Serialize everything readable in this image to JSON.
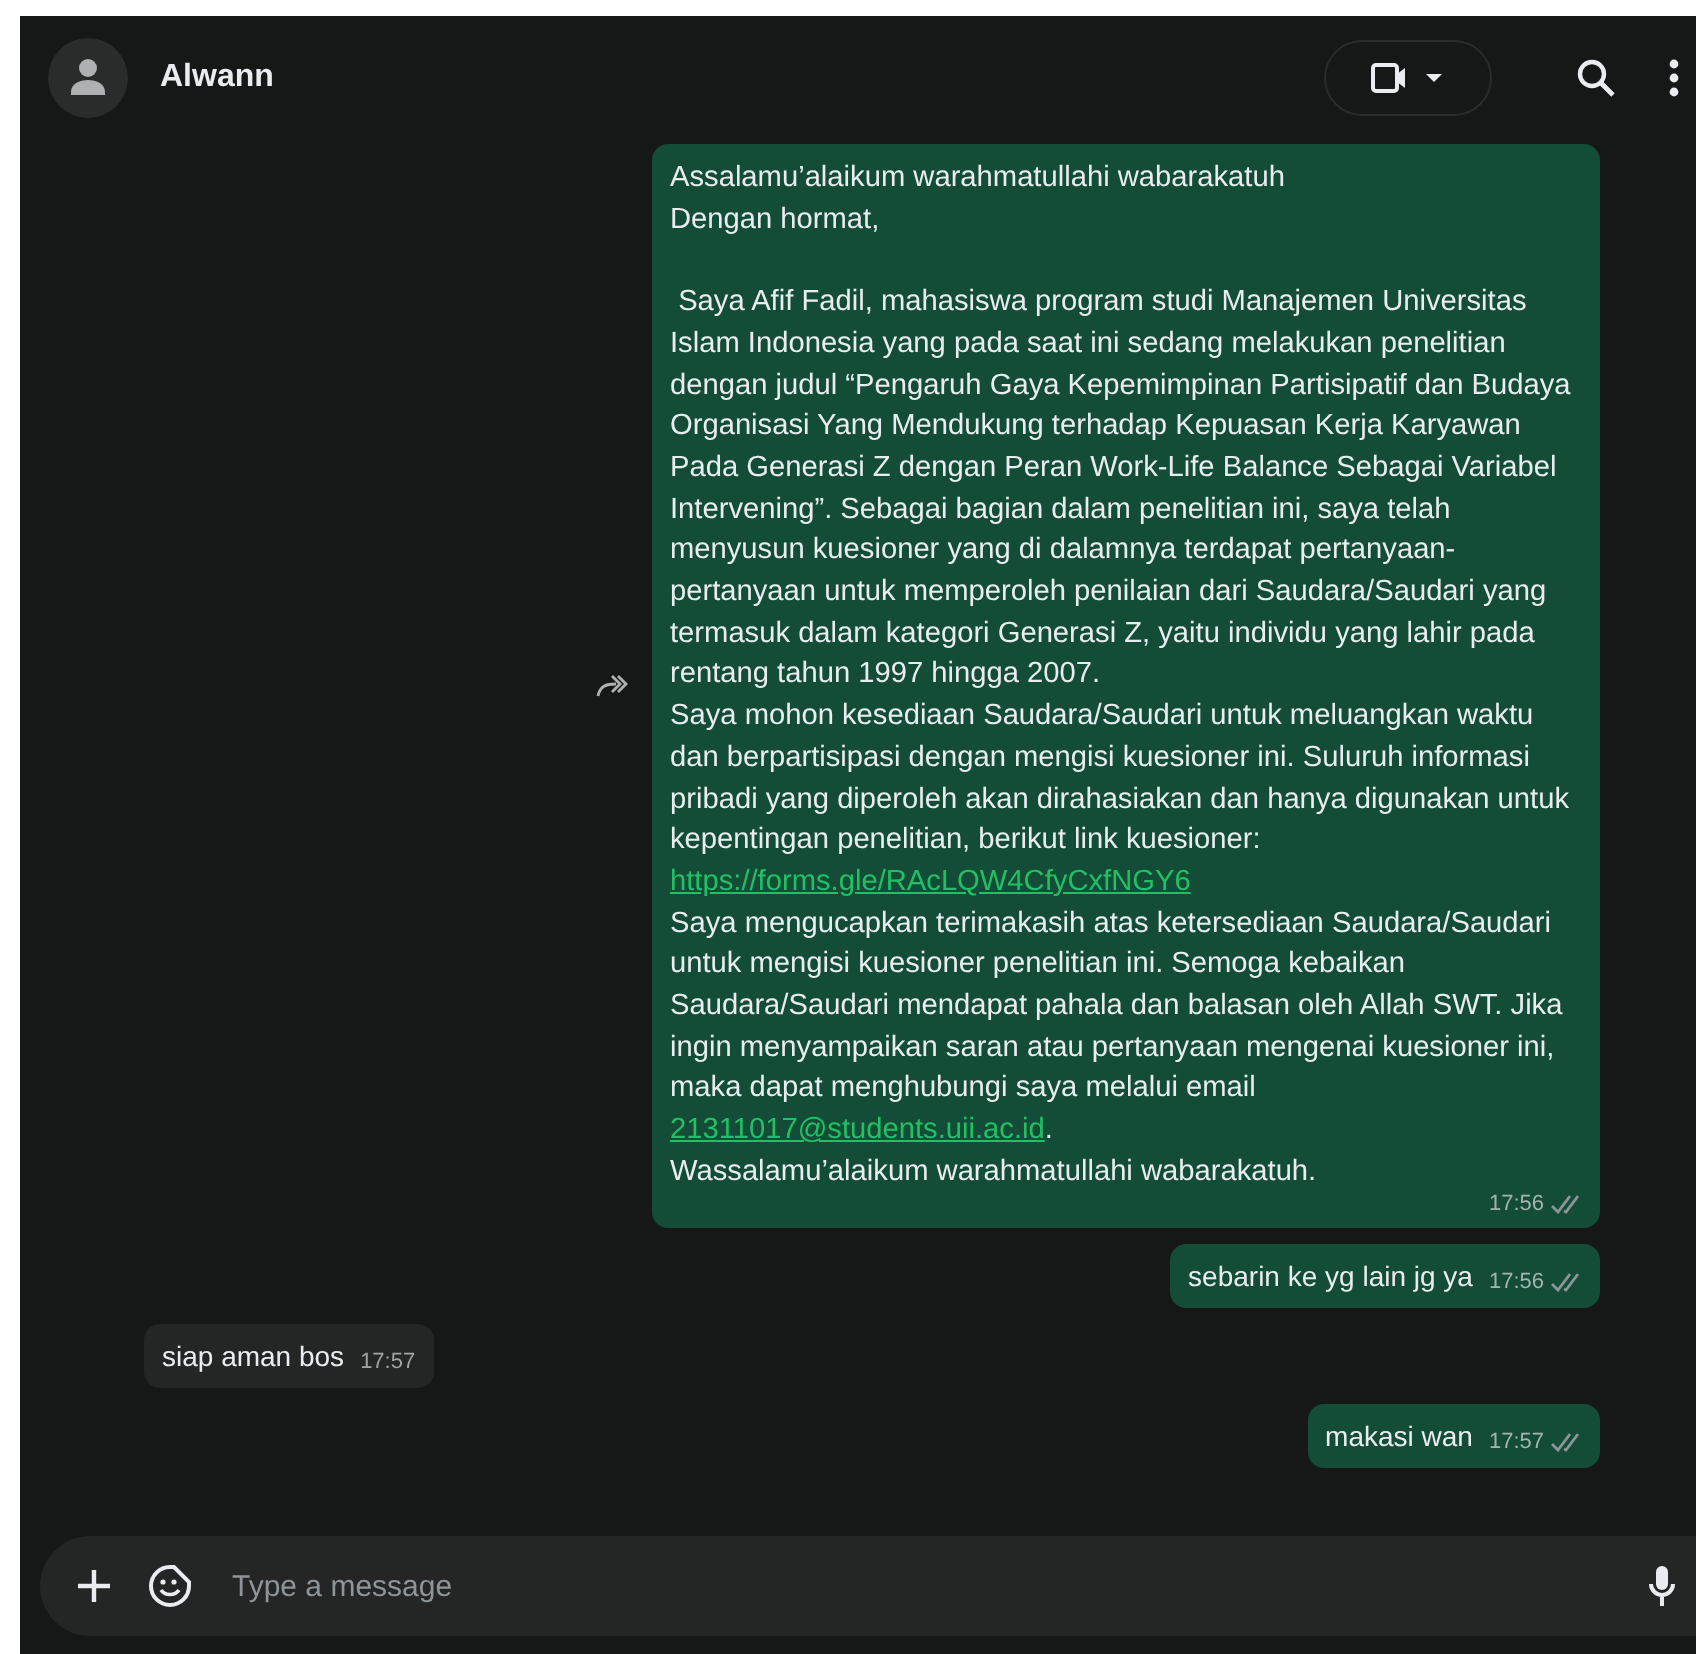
{
  "header": {
    "contact_name": "Alwann"
  },
  "messages": [
    {
      "kind": "outgoing",
      "forward_button": true,
      "read": false,
      "time": "17:56",
      "parts": [
        {
          "kind": "text",
          "text": "Assalamu’alaikum warahmatullahi wabarakatuh\nDengan hormat,\n\n Saya Afif Fadil, mahasiswa program studi Manajemen Universitas Islam Indonesia yang pada saat ini sedang melakukan penelitian dengan judul “Pengaruh Gaya Kepemimpinan Partisipatif dan Budaya Organisasi Yang Mendukung terhadap Kepuasan Kerja Karyawan Pada Generasi Z dengan Peran Work-Life Balance Sebagai Variabel Intervening”. Sebagai bagian dalam penelitian ini, saya telah menyusun kuesioner yang di dalamnya terdapat pertanyaan-pertanyaan untuk memperoleh penilaian dari Saudara/Saudari yang termasuk dalam kategori Generasi Z, yaitu individu yang lahir pada rentang tahun 1997 hingga 2007.\nSaya mohon kesediaan Saudara/Saudari untuk meluangkan waktu dan berpartisipasi dengan mengisi kuesioner ini. Suluruh informasi pribadi yang diperoleh akan dirahasiakan dan hanya digunakan untuk kepentingan penelitian, berikut link kuesioner:\n"
        },
        {
          "kind": "link",
          "text": "https://forms.gle/RAcLQW4CfyCxfNGY6"
        },
        {
          "kind": "text",
          "text": "\nSaya mengucapkan terimakasih atas ketersediaan Saudara/Saudari untuk mengisi kuesioner penelitian ini. Semoga kebaikan Saudara/Saudari mendapat pahala dan balasan oleh Allah SWT. Jika ingin menyampaikan saran atau pertanyaan mengenai kuesioner ini, maka dapat menghubungi saya melalui email\n"
        },
        {
          "kind": "link",
          "text": "21311017@students.uii.ac.id"
        },
        {
          "kind": "text",
          "text": ".\nWassalamu’alaikum warahmatullahi wabarakatuh."
        }
      ]
    },
    {
      "kind": "outgoing",
      "forward_button": false,
      "read": false,
      "time": "17:56",
      "parts": [
        {
          "kind": "text",
          "text": "sebarin ke yg lain jg ya"
        }
      ]
    },
    {
      "kind": "incoming",
      "forward_button": false,
      "time": "17:57",
      "parts": [
        {
          "kind": "text",
          "text": "siap aman bos"
        }
      ]
    },
    {
      "kind": "outgoing",
      "forward_button": false,
      "read": false,
      "time": "17:57",
      "parts": [
        {
          "kind": "text",
          "text": "makasi wan"
        }
      ]
    }
  ],
  "composer": {
    "placeholder": "Type a message"
  }
}
